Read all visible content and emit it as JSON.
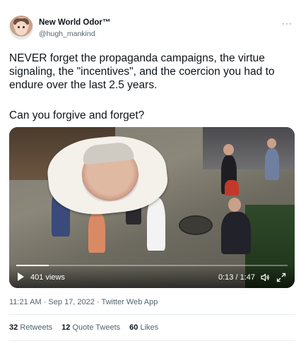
{
  "author": {
    "name": "New World Odor™",
    "handle": "@hugh_mankind",
    "avatar_icon": "avatar-photo"
  },
  "more_label": "···",
  "tweet": {
    "text": "NEVER forget the propaganda campaigns, the virtue signaling, the \"incentives\", and the coercion you had to endure over the last 2.5 years.",
    "question": "Can you forgive and forget?"
  },
  "video": {
    "views": "401 views",
    "time": "0:13 / 1:47",
    "progress": 0.121,
    "icons": [
      "play-icon",
      "volume-icon",
      "expand-icon"
    ]
  },
  "meta": {
    "timestamp": "11:21 AM · Sep 17, 2022 · Twitter Web App"
  },
  "stats": {
    "retweets_count": "32",
    "retweets_label": "Retweets",
    "quotes_count": "12",
    "quotes_label": "Quote Tweets",
    "likes_count": "60",
    "likes_label": "Likes"
  },
  "colors": {
    "text": "#0f1419",
    "secondary": "#536471",
    "divider": "#e6ecf0"
  }
}
